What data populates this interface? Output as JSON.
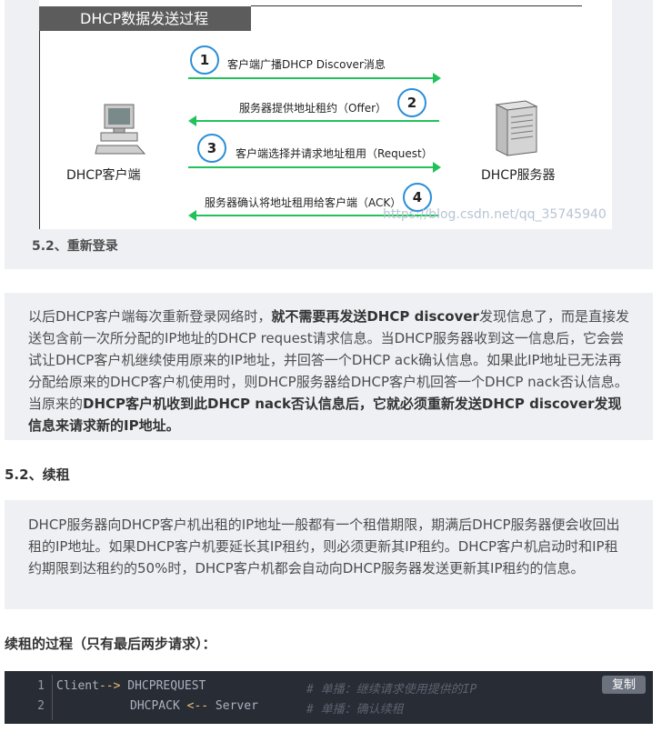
{
  "diagram": {
    "title": "DHCP数据发送过程",
    "client_label": "DHCP客户端",
    "server_label": "DHCP服务器",
    "steps": [
      {
        "num": "1",
        "text": "客户端广播DHCP Discover消息"
      },
      {
        "num": "2",
        "text": "服务器提供地址租约（Offer）"
      },
      {
        "num": "3",
        "text": "客户端选择并请求地址租用（Request）"
      },
      {
        "num": "4",
        "text": "服务器确认将地址租用给客户端（ACK）"
      }
    ],
    "watermark": "https://blog.csdn.net/qq_35745940",
    "colors": {
      "arrow": "#21c25a",
      "circle": "#2a8fd8"
    }
  },
  "section_relogin": {
    "heading": "5.2、重新登录"
  },
  "quote1": {
    "t1": "以后DHCP客户端每次重新登录网络时，",
    "b1": "就不需要再发送DHCP discover",
    "t2": "发现信息了，而是直接发送包含前一次所分配的IP地址的DHCP request请求信息。当DHCP服务器收到这一信息后，它会尝试让DHCP客户机继续使用原来的IP地址，并回答一个DHCP ack确认信息。如果此IP地址已无法再分配给原来的DHCP客户机使用时，则DHCP服务器给DHCP客户机回答一个DHCP nack否认信息。当原来的",
    "b2": "DHCP客户机收到此DHCP nack否认信息后，它就必须重新发送DHCP discover发现信息来请求新的IP地址。"
  },
  "section_renew": {
    "heading": "5.2、续租"
  },
  "quote2": {
    "text": "DHCP服务器向DHCP客户机出租的IP地址一般都有一个租借期限，期满后DHCP服务器便会收回出租的IP地址。如果DHCP客户机要延长其IP租约，则必须更新其IP租约。DHCP客户机启动时和IP租约期限到达租约的50%时，DHCP客户机都会自动向DHCP服务器发送更新其IP租约的信息。"
  },
  "renew_process": {
    "heading": "续租的过程（只有最后两步请求）："
  },
  "code": {
    "copy_label": "复制",
    "lines": [
      {
        "num": "1",
        "a": "Client",
        "arrow": "-->",
        "b": " DHCPREQUEST",
        "comment": "# 单播：继续请求使用提供的IP"
      },
      {
        "num": "2",
        "a": "",
        "arrow": "",
        "b": "DHCPACK",
        "arrow2": "<--",
        "c": " Server",
        "comment": "# 单播：确认续租"
      }
    ]
  }
}
